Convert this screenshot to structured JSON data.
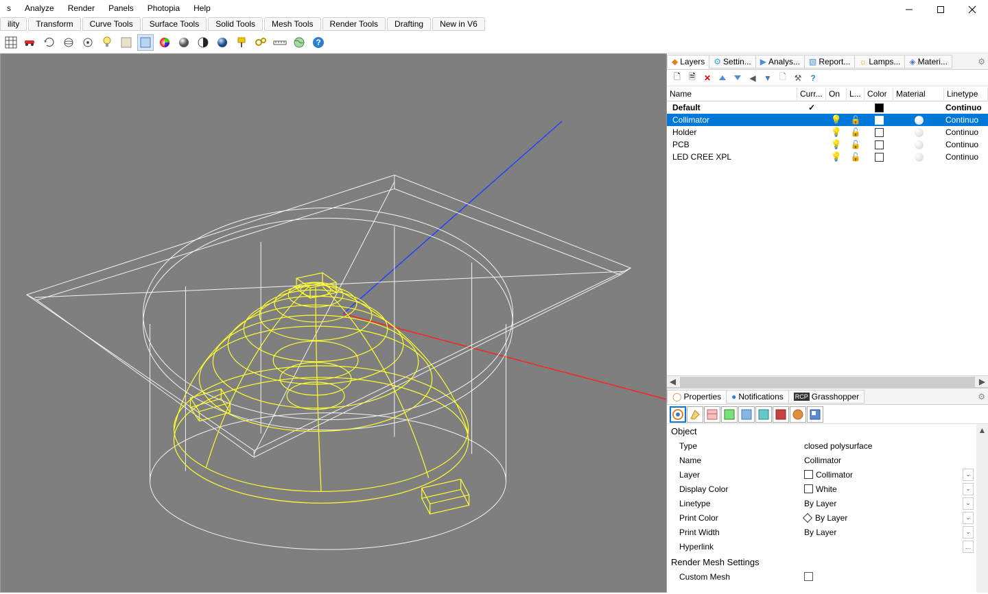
{
  "menubar": [
    "s",
    "Analyze",
    "Render",
    "Panels",
    "Photopia",
    "Help"
  ],
  "tabbar": [
    "ility",
    "Transform",
    "Curve Tools",
    "Surface Tools",
    "Solid Tools",
    "Mesh Tools",
    "Render Tools",
    "Drafting",
    "New in V6"
  ],
  "layers_panel": {
    "tabs": [
      {
        "label": "Layers",
        "color": "#e67e22"
      },
      {
        "label": "Settin...",
        "color": "#3aa6d0"
      },
      {
        "label": "Analys...",
        "color": "#4a90d9"
      },
      {
        "label": "Report...",
        "color": "#4a90d9"
      },
      {
        "label": "Lamps...",
        "color": "#d9a300"
      },
      {
        "label": "Materi...",
        "color": "#4a7bc8"
      }
    ],
    "headers": {
      "name": "Name",
      "curr": "Curr...",
      "on": "On",
      "lo": "L...",
      "color": "Color",
      "material": "Material",
      "linetype": "Linetype"
    },
    "rows": [
      {
        "name": "Default",
        "curr": "✓",
        "color": "#000000",
        "lt": "Continuo",
        "default": true,
        "selected": false
      },
      {
        "name": "Collimator",
        "curr": "",
        "color": "#ffffff",
        "lt": "Continuo",
        "default": false,
        "selected": true,
        "showmat": true
      },
      {
        "name": "Holder",
        "curr": "",
        "color": "#ffffff",
        "lt": "Continuo",
        "default": false,
        "selected": false
      },
      {
        "name": "PCB",
        "curr": "",
        "color": "#ffffff",
        "lt": "Continuo",
        "default": false,
        "selected": false
      },
      {
        "name": "LED CREE XPL",
        "curr": "",
        "color": "#ffffff",
        "lt": "Continuo",
        "default": false,
        "selected": false
      }
    ]
  },
  "properties_panel": {
    "tabs": [
      "Properties",
      "Notifications",
      "Grasshopper"
    ],
    "section": "Object",
    "rows": [
      {
        "label": "Type",
        "value": "closed polysurface",
        "dd": false
      },
      {
        "label": "Name",
        "value": "Collimator",
        "dd": false
      },
      {
        "label": "Layer",
        "value": "Collimator",
        "dd": true,
        "swatch": "#ffffff"
      },
      {
        "label": "Display Color",
        "value": "White",
        "dd": true,
        "swatch": "#ffffff"
      },
      {
        "label": "Linetype",
        "value": "By Layer",
        "dd": true
      },
      {
        "label": "Print Color",
        "value": "By Layer",
        "dd": true,
        "diamond": true
      },
      {
        "label": "Print Width",
        "value": "By Layer",
        "dd": true
      },
      {
        "label": "Hyperlink",
        "value": "",
        "dd": false,
        "ellipsis": true
      }
    ],
    "section2": "Render Mesh Settings",
    "rows2": [
      {
        "label": "Custom Mesh",
        "value": "",
        "checkbox": true
      }
    ]
  }
}
